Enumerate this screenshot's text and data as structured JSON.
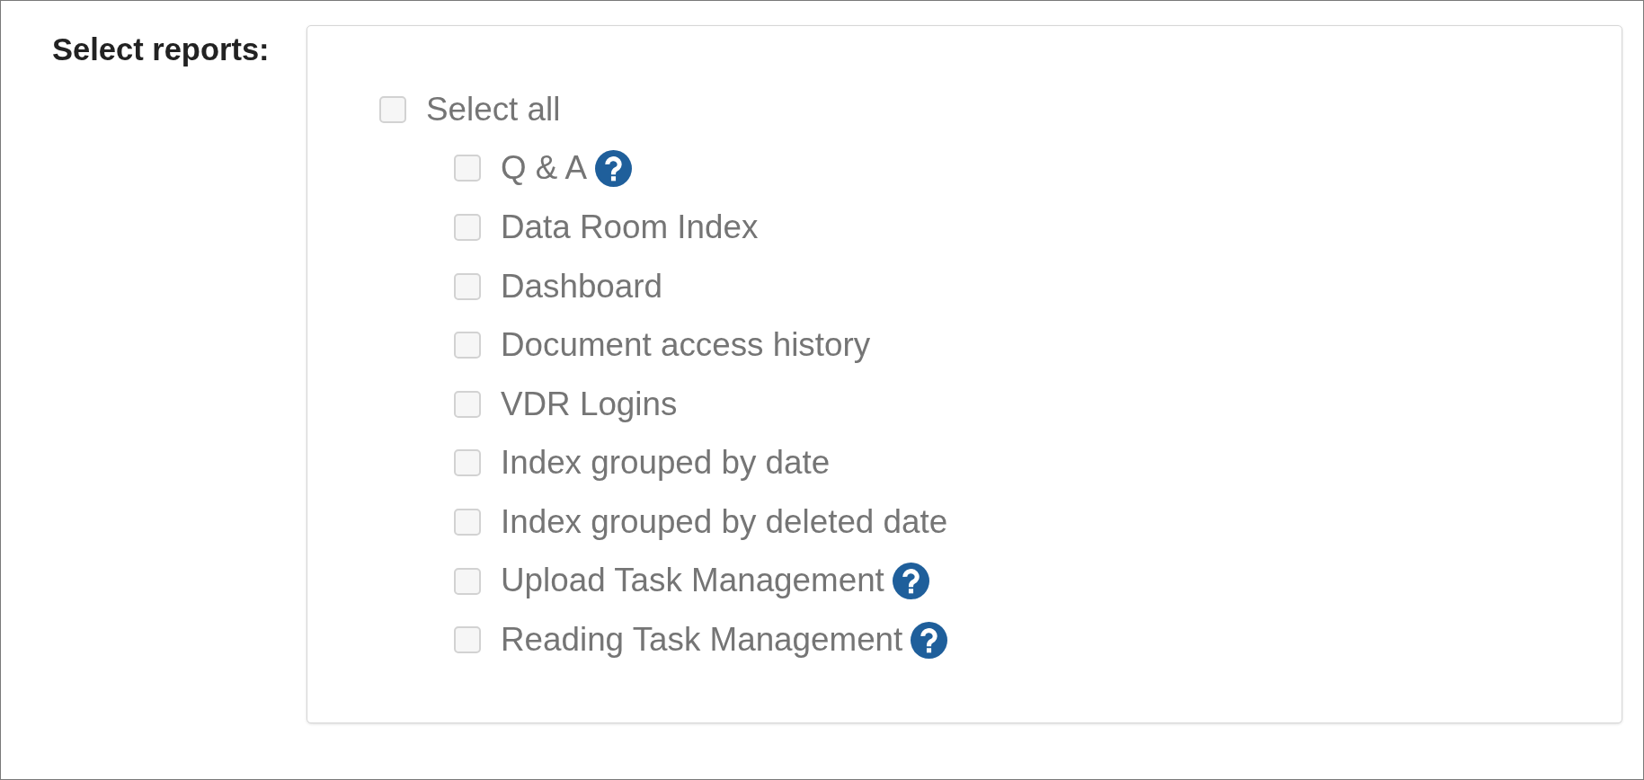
{
  "field_label": "Select reports:",
  "select_all": {
    "label": "Select all",
    "checked": false
  },
  "reports": [
    {
      "label": "Q & A",
      "checked": false,
      "help_icon": true
    },
    {
      "label": "Data Room Index",
      "checked": false,
      "help_icon": false
    },
    {
      "label": "Dashboard",
      "checked": false,
      "help_icon": false
    },
    {
      "label": "Document access history",
      "checked": false,
      "help_icon": false
    },
    {
      "label": "VDR Logins",
      "checked": false,
      "help_icon": false
    },
    {
      "label": "Index grouped by date",
      "checked": false,
      "help_icon": false
    },
    {
      "label": "Index grouped by deleted date",
      "checked": false,
      "help_icon": false
    },
    {
      "label": "Upload Task Management",
      "checked": false,
      "help_icon": true
    },
    {
      "label": "Reading Task Management",
      "checked": false,
      "help_icon": true
    }
  ]
}
